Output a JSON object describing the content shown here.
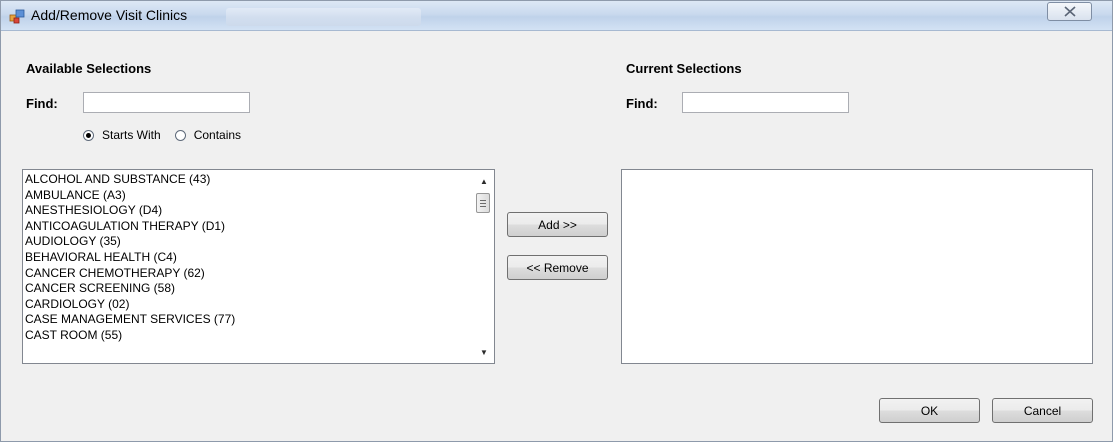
{
  "window": {
    "title": "Add/Remove Visit Clinics",
    "close_symbol": "X"
  },
  "available": {
    "heading": "Available Selections",
    "find_label": "Find:",
    "find_value": "",
    "match_mode": {
      "options": [
        "Starts With",
        "Contains"
      ],
      "selected": "Starts With"
    },
    "items": [
      "ALCOHOL AND SUBSTANCE (43)",
      "AMBULANCE (A3)",
      "ANESTHESIOLOGY (D4)",
      "ANTICOAGULATION THERAPY (D1)",
      "AUDIOLOGY (35)",
      "BEHAVIORAL HEALTH (C4)",
      "CANCER CHEMOTHERAPY (62)",
      "CANCER SCREENING (58)",
      "CARDIOLOGY (02)",
      "CASE MANAGEMENT SERVICES (77)",
      "CAST ROOM (55)"
    ]
  },
  "current": {
    "heading": "Current Selections",
    "find_label": "Find:",
    "find_value": "",
    "items": []
  },
  "actions": {
    "add_label": "Add >>",
    "remove_label": "<< Remove",
    "ok_label": "OK",
    "cancel_label": "Cancel"
  },
  "colors": {
    "window_bg": "#f0f0f0",
    "titlebar": "#c9d9ee",
    "list_border": "#828790"
  }
}
